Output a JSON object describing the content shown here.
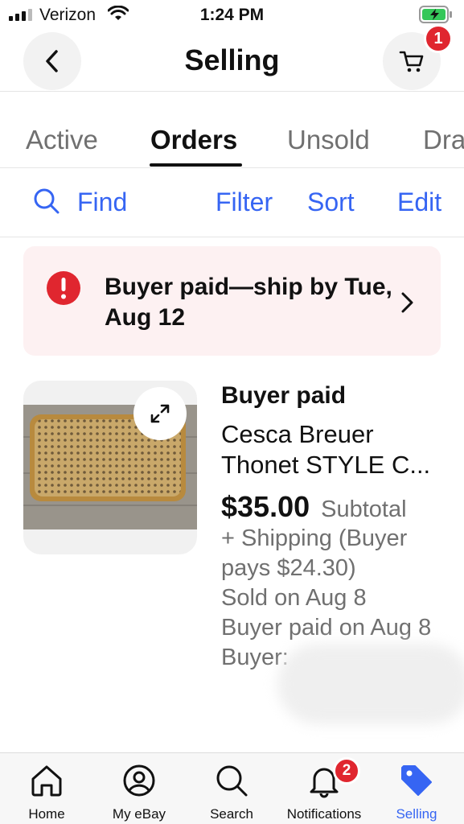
{
  "status_bar": {
    "carrier": "Verizon",
    "time": "1:24 PM"
  },
  "header": {
    "title": "Selling",
    "cart_count": "1"
  },
  "tabs": [
    {
      "label": "Active"
    },
    {
      "label": "Orders"
    },
    {
      "label": "Unsold"
    },
    {
      "label": "Drafts"
    }
  ],
  "toolbar": {
    "find_label": "Find",
    "filter_label": "Filter",
    "sort_label": "Sort",
    "edit_label": "Edit"
  },
  "alert": {
    "text": "Buyer paid—ship by Tue, Aug 12"
  },
  "order": {
    "status": "Buyer paid",
    "title": "Cesca Breuer Thonet STYLE C...",
    "price": "$35.00",
    "price_label": "Subtotal",
    "details": [
      "+ Shipping (Buyer pays $24.30)",
      "Sold on Aug 8",
      "Buyer paid on Aug 8",
      "Buyer:"
    ]
  },
  "bottom_nav": {
    "items": [
      {
        "label": "Home",
        "icon": "home-icon"
      },
      {
        "label": "My eBay",
        "icon": "account-icon"
      },
      {
        "label": "Search",
        "icon": "search-icon"
      },
      {
        "label": "Notifications",
        "icon": "bell-icon"
      },
      {
        "label": "Selling",
        "icon": "tag-icon"
      }
    ],
    "notifications_count": "2"
  },
  "colors": {
    "accent": "#3665f3",
    "badge": "#e0262f",
    "alert_bg": "#fdf1f2"
  }
}
